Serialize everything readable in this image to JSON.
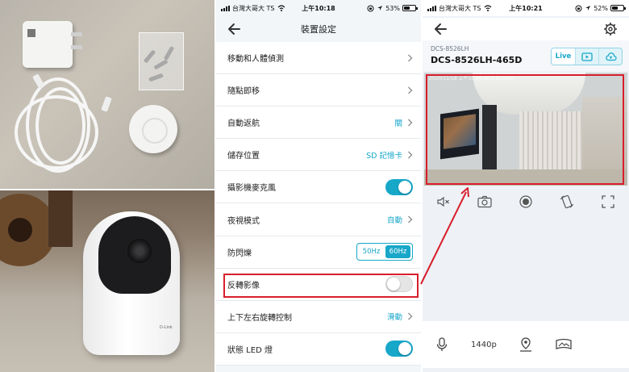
{
  "photos": {
    "brand_text": "D-Link"
  },
  "settings_screen": {
    "status": {
      "carrier": "台灣大哥大 TS",
      "time": "上午10:18",
      "battery": "53%",
      "battery_level": 0.53
    },
    "title": "裝置設定",
    "rows": [
      {
        "label": "移動和人體偵測",
        "kind": "nav",
        "value": ""
      },
      {
        "label": "隨點即移",
        "kind": "nav",
        "value": ""
      },
      {
        "label": "自動返航",
        "kind": "nav",
        "value": "關"
      },
      {
        "label": "儲存位置",
        "kind": "nav",
        "value": "SD 記憶卡"
      },
      {
        "label": "攝影機麥克風",
        "kind": "toggle",
        "on": true
      },
      {
        "label": "夜視模式",
        "kind": "nav",
        "value": "自動"
      },
      {
        "label": "防閃爍",
        "kind": "segmented",
        "options": [
          "50Hz",
          "60Hz"
        ],
        "selected": "60Hz"
      },
      {
        "label": "反轉影像",
        "kind": "toggle",
        "on": false
      },
      {
        "label": "上下左右旋轉控制",
        "kind": "nav",
        "value": "滑動"
      },
      {
        "label": "狀態 LED 燈",
        "kind": "toggle",
        "on": true
      }
    ]
  },
  "camera_screen": {
    "status": {
      "carrier": "台灣大哥大 TS",
      "time": "上午10:21",
      "battery": "52%",
      "battery_level": 0.52
    },
    "device_model": "DCS-8526LH",
    "device_name": "DCS-8526LH-465D",
    "mode_live": "Live",
    "video_timestamp": "2020/11/18  上午10:20  DCS-8526LH",
    "resolution": "1440p"
  },
  "colors": {
    "accent": "#16a7c9",
    "highlight": "#d81e2c"
  },
  "icons": [
    "back-arrow-icon",
    "chevron-right-icon",
    "gear-icon",
    "playback-icon",
    "cloud-icon",
    "mute-icon",
    "camera-icon",
    "record-icon",
    "rotate-icon",
    "fullscreen-icon",
    "microphone-icon",
    "location-pin-icon",
    "panorama-icon"
  ]
}
